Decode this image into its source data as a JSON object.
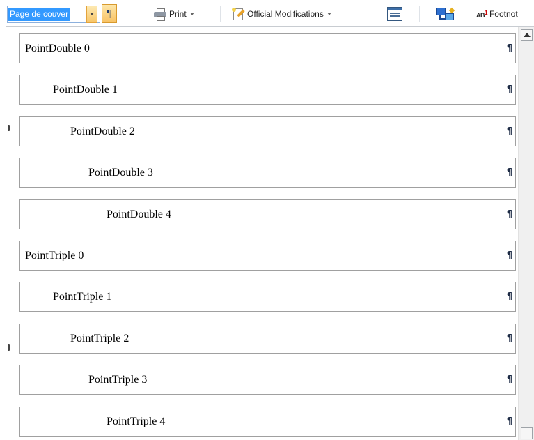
{
  "toolbar": {
    "style_combo_value": "Page de couver",
    "show_marks_glyph": "¶",
    "print_label": "Print",
    "official_mods_label": "Official Modifications",
    "footnote_label": "Footnot"
  },
  "gallery": {
    "pilcrow": "¶",
    "items": [
      {
        "label": "PointDouble 0"
      },
      {
        "label": "PointDouble 1"
      },
      {
        "label": "PointDouble 2"
      },
      {
        "label": "PointDouble 3"
      },
      {
        "label": "PointDouble 4"
      },
      {
        "label": "PointTriple 0"
      },
      {
        "label": "PointTriple 1"
      },
      {
        "label": "PointTriple 2"
      },
      {
        "label": "PointTriple 3"
      },
      {
        "label": "PointTriple 4"
      }
    ]
  },
  "icons": [
    "printer-icon",
    "official-modifications-icon",
    "form-icon",
    "network-icon",
    "footnote-icon",
    "scroll-up-icon",
    "chevron-down-icon"
  ],
  "colors": {
    "selection": "#3399ff",
    "accent_orange": "#f8c264"
  }
}
